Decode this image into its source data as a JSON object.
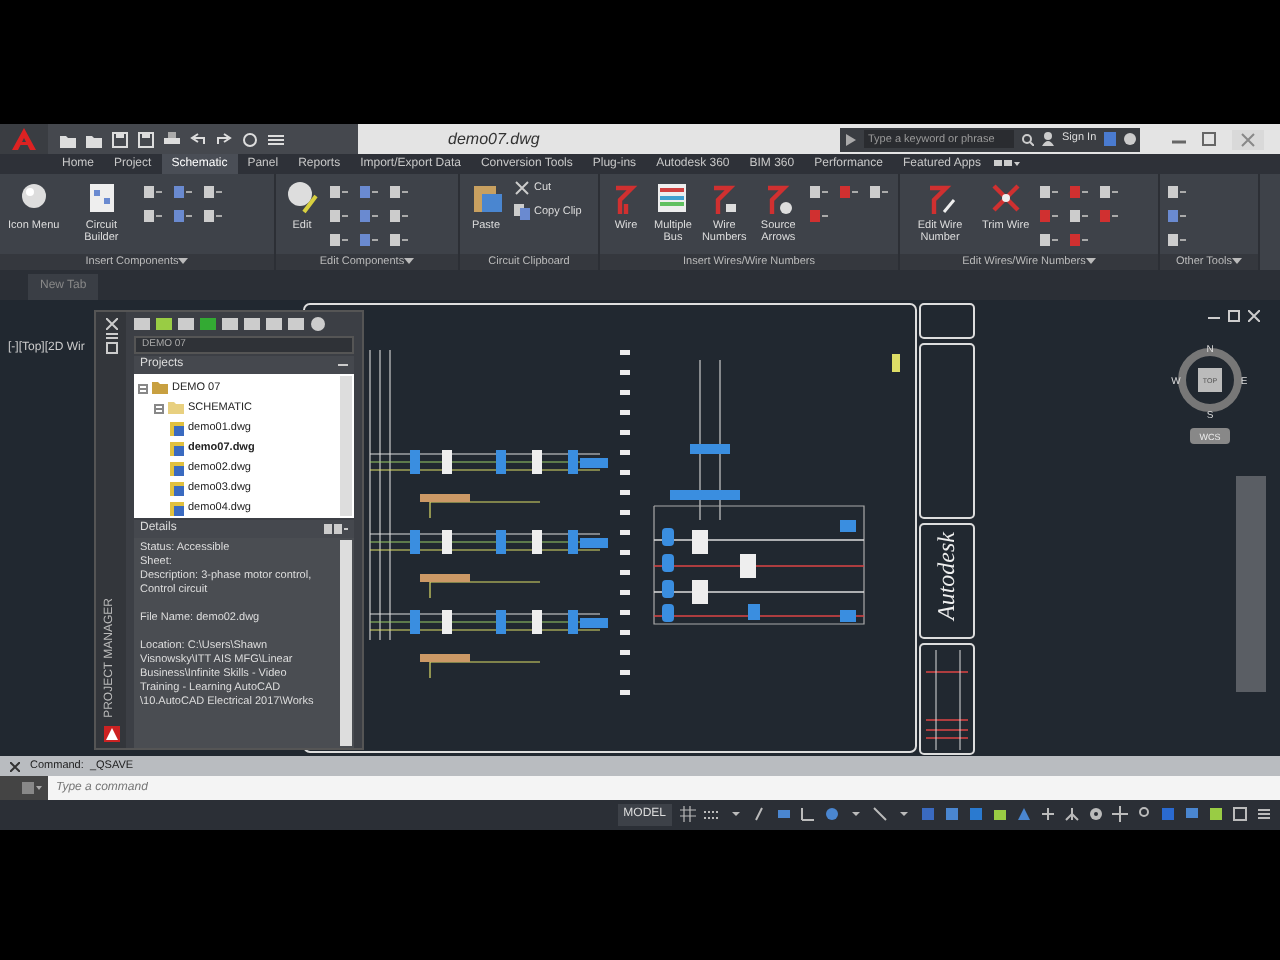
{
  "title_bar": {
    "title": "demo07.dwg",
    "search_placeholder": "Type a keyword or phrase",
    "sign_in": "Sign In"
  },
  "ribbon_tabs": [
    {
      "label": "Home",
      "selected": false
    },
    {
      "label": "Project",
      "selected": false
    },
    {
      "label": "Schematic",
      "selected": true
    },
    {
      "label": "Panel",
      "selected": false
    },
    {
      "label": "Reports",
      "selected": false
    },
    {
      "label": "Import/Export Data",
      "selected": false
    },
    {
      "label": "Conversion Tools",
      "selected": false
    },
    {
      "label": "Plug-ins",
      "selected": false
    },
    {
      "label": "Autodesk 360",
      "selected": false
    },
    {
      "label": "BIM 360",
      "selected": false
    },
    {
      "label": "Performance",
      "selected": false
    },
    {
      "label": "Featured Apps",
      "selected": false
    }
  ],
  "ribbon_panels": [
    {
      "title": "Insert Components",
      "dropdown": true,
      "buttons": [
        {
          "kind": "large",
          "label": "Icon Menu"
        },
        {
          "kind": "large",
          "label": "Circuit Builder"
        }
      ]
    },
    {
      "title": "Edit Components",
      "dropdown": true,
      "buttons": [
        {
          "kind": "large",
          "label": "Edit"
        }
      ]
    },
    {
      "title": "Circuit Clipboard",
      "dropdown": false,
      "buttons": [
        {
          "kind": "large",
          "label": "Paste"
        },
        {
          "kind": "small",
          "label": "Cut"
        },
        {
          "kind": "small",
          "label": "Copy Clip"
        }
      ]
    },
    {
      "title": "Insert Wires/Wire Numbers",
      "dropdown": false,
      "buttons": [
        {
          "kind": "large",
          "label": "Wire"
        },
        {
          "kind": "large",
          "label": "Multiple Bus"
        },
        {
          "kind": "large",
          "label": "Wire Numbers"
        },
        {
          "kind": "large",
          "label": "Source Arrows"
        }
      ]
    },
    {
      "title": "Edit Wires/Wire Numbers",
      "dropdown": true,
      "buttons": [
        {
          "kind": "large",
          "label": "Edit Wire Number"
        },
        {
          "kind": "large",
          "label": "Trim Wire"
        }
      ]
    },
    {
      "title": "Other Tools",
      "dropdown": true
    }
  ],
  "file_tabs": [
    {
      "label": "New Tab",
      "selected": false
    }
  ],
  "viewport_label": "[-][Top][2D Wir",
  "project_manager": {
    "title": "PROJECT MANAGER",
    "project_dropdown": "DEMO 07",
    "projects_header": "Projects",
    "tree": [
      {
        "label": "DEMO 07",
        "expanded": true,
        "children": [
          {
            "label": "SCHEMATIC",
            "expanded": true,
            "children": [
              {
                "label": "demo01.dwg",
                "selected": false
              },
              {
                "label": "demo07.dwg",
                "selected": true
              },
              {
                "label": "demo02.dwg",
                "selected": false
              },
              {
                "label": "demo03.dwg",
                "selected": false
              },
              {
                "label": "demo04.dwg",
                "selected": false
              }
            ]
          }
        ]
      }
    ],
    "details_header": "Details",
    "details_paragraphs": [
      [
        "Status: Accessible",
        "Sheet:",
        "Description: 3-phase motor control,",
        "Control circuit"
      ],
      [
        "File Name: demo02.dwg"
      ],
      [
        "Location: C:\\Users\\Shawn",
        "Visnowsky\\ITT AIS MFG\\Linear",
        "Business\\Infinite Skills - Video",
        "Training - Learning AutoCAD",
        "\\10.AutoCAD Electrical 2017\\Works"
      ]
    ]
  },
  "drawing": {
    "title_block_logo": "Autodesk"
  },
  "view_cube": {
    "north": "N",
    "south": "S",
    "east": "E",
    "west": "W",
    "face": "TOP",
    "ucs": "WCS"
  },
  "command_line": {
    "history": "Command:  _QSAVE",
    "placeholder": "Type a command"
  },
  "status_bar": {
    "model": "MODEL"
  }
}
